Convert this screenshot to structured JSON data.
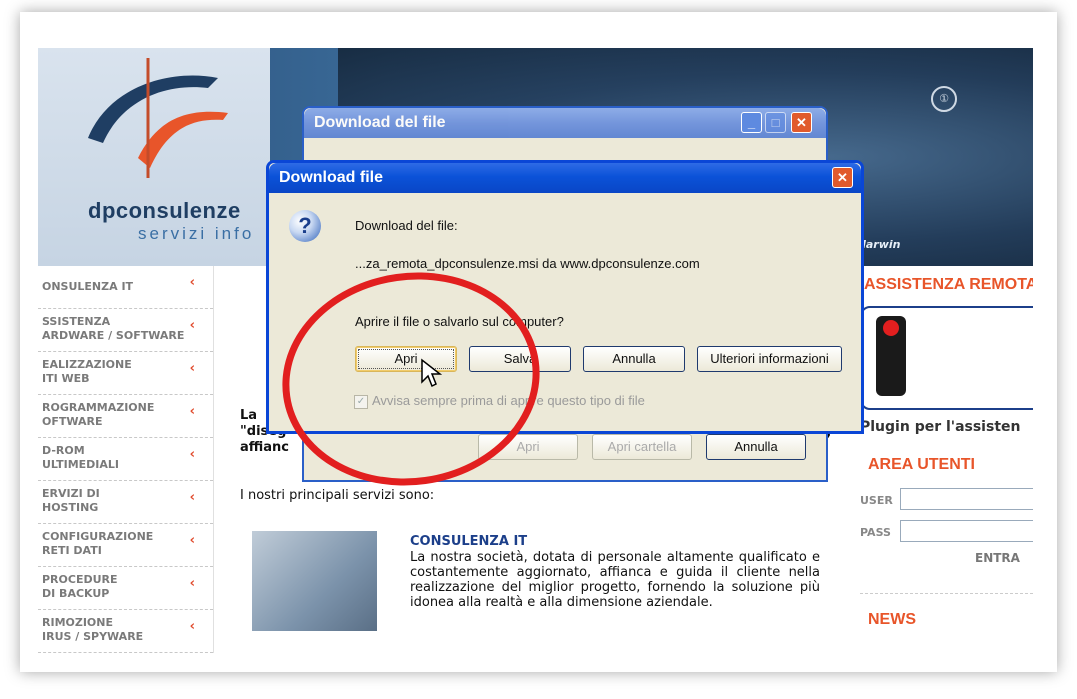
{
  "header": {
    "brand_name": "dpconsulenze",
    "brand_tagline": "servizi info",
    "photo_label": "Ilarwin"
  },
  "leftnav": {
    "items": [
      {
        "line1": "ONSULENZA IT",
        "line2": ""
      },
      {
        "line1": "SSISTENZA",
        "line2": "ARDWARE / SOFTWARE"
      },
      {
        "line1": "EALIZZAZIONE",
        "line2": "ITI WEB"
      },
      {
        "line1": "ROGRAMMAZIONE",
        "line2": "OFTWARE"
      },
      {
        "line1": "D-ROM",
        "line2": "ULTIMEDIALI"
      },
      {
        "line1": "ERVIZI DI",
        "line2": "HOSTING"
      },
      {
        "line1": "CONFIGURAZIONE",
        "line2": "RETI DATI"
      },
      {
        "line1": "PROCEDURE",
        "line2": "DI BACKUP"
      },
      {
        "line1": "RIMOZIONE",
        "line2": "IRUS / SPYWARE"
      }
    ],
    "chevron": "‹"
  },
  "center": {
    "intro_line1": "La",
    "intro_line2": "\"diseg",
    "intro_line3": "affianc",
    "intro_tail": ",",
    "services_line": "I nostri principali servizi sono:",
    "service_title": "CONSULENZA IT",
    "service_text": "La nostra società, dotata di personale altamente qualificato e costantemente aggiornato, affianca e guida il cliente nella realizzazione del miglior progetto, fornendo la soluzione più idonea alla realtà e alla dimensione aziendale."
  },
  "rightcol": {
    "assist_title": "ASSISTENZA REMOTA",
    "plugin_text": "Plugin per l'assisten",
    "area_title": "AREA UTENTI",
    "user_label": "USER",
    "pass_label": "PASS",
    "entra_label": "ENTRA",
    "news_title": "NEWS"
  },
  "back_dialog": {
    "title": "Download del file",
    "btn_open": "Apri",
    "btn_open_folder": "Apri cartella",
    "btn_cancel": "Annulla"
  },
  "front_dialog": {
    "title": "Download file",
    "label": "Download del file:",
    "filename": "...za_remota_dpconsulenze.msi da www.dpconsulenze.com",
    "question": "Aprire il file o salvarlo sul computer?",
    "btn_open": "Apri",
    "btn_save": "Salva",
    "btn_cancel": "Annulla",
    "btn_more": "Ulteriori informazioni",
    "checkbox_label": "Avvisa sempre prima di aprire questo tipo di file",
    "checkbox_checked": true
  },
  "icons": {
    "question": "question-icon",
    "close": "close-icon",
    "minimize": "minimize-icon",
    "maximize": "maximize-icon",
    "traffic_light": "traffic-light-icon",
    "cursor": "mouse-cursor-icon"
  },
  "colors": {
    "xp_title": "#0a46d6",
    "accent_orange": "#e8552a",
    "annotation_red": "#e21f1f",
    "link_blue": "#1c3f8a"
  }
}
